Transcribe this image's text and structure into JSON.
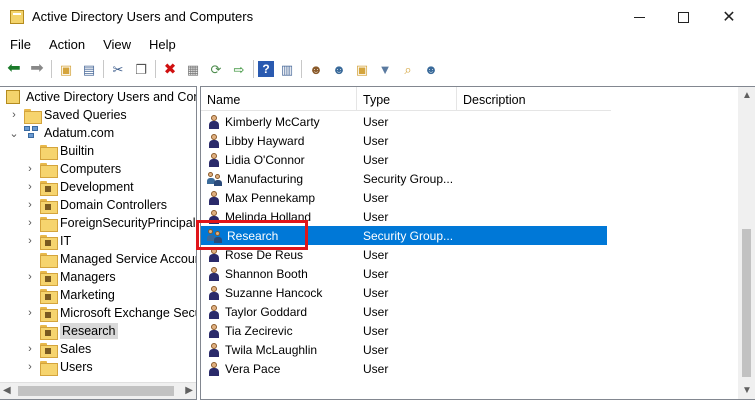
{
  "window": {
    "title": "Active Directory Users and Computers",
    "controls": {
      "minimize": "minimize",
      "maximize": "maximize",
      "close": "close"
    }
  },
  "menu": [
    "File",
    "Action",
    "View",
    "Help"
  ],
  "toolbar": {
    "icons": [
      "back-icon",
      "forward-icon",
      "up-folder-icon",
      "show-tree-icon",
      "cut-icon",
      "copy-icon",
      "delete-icon",
      "properties-icon",
      "refresh-icon",
      "export-icon",
      "help-icon",
      "console-icon",
      "new-user-icon",
      "new-group-icon",
      "new-ou-icon",
      "filter-icon",
      "find-icon",
      "add-to-group-icon"
    ]
  },
  "tree": {
    "root": "Active Directory Users and Com",
    "saved_queries": "Saved Queries",
    "domain": "Adatum.com",
    "children": [
      {
        "label": "Builtin",
        "type": "container",
        "expandable": false
      },
      {
        "label": "Computers",
        "type": "container",
        "expandable": true
      },
      {
        "label": "Development",
        "type": "ou",
        "expandable": true
      },
      {
        "label": "Domain Controllers",
        "type": "ou",
        "expandable": true
      },
      {
        "label": "ForeignSecurityPrincipals",
        "type": "container",
        "expandable": true
      },
      {
        "label": "IT",
        "type": "ou",
        "expandable": true
      },
      {
        "label": "Managed Service Accoun",
        "type": "container",
        "expandable": false
      },
      {
        "label": "Managers",
        "type": "ou",
        "expandable": true
      },
      {
        "label": "Marketing",
        "type": "ou",
        "expandable": false
      },
      {
        "label": "Microsoft Exchange Secu",
        "type": "ou",
        "expandable": true
      },
      {
        "label": "Research",
        "type": "ou",
        "expandable": false,
        "selected": true
      },
      {
        "label": "Sales",
        "type": "ou",
        "expandable": true
      },
      {
        "label": "Users",
        "type": "container",
        "expandable": true
      }
    ]
  },
  "list": {
    "columns": {
      "name": "Name",
      "type": "Type",
      "description": "Description"
    },
    "rows": [
      {
        "name": "Kimberly McCarty",
        "type": "User",
        "icon": "user-icon"
      },
      {
        "name": "Libby Hayward",
        "type": "User",
        "icon": "user-icon"
      },
      {
        "name": "Lidia O'Connor",
        "type": "User",
        "icon": "user-icon"
      },
      {
        "name": "Manufacturing",
        "type": "Security Group...",
        "icon": "group-icon"
      },
      {
        "name": "Max Pennekamp",
        "type": "User",
        "icon": "user-icon"
      },
      {
        "name": "Melinda Holland",
        "type": "User",
        "icon": "user-icon"
      },
      {
        "name": "Research",
        "type": "Security Group...",
        "icon": "group-icon",
        "selected": true
      },
      {
        "name": "Rose De Reus",
        "type": "User",
        "icon": "user-icon"
      },
      {
        "name": "Shannon Booth",
        "type": "User",
        "icon": "user-icon"
      },
      {
        "name": "Suzanne Hancock",
        "type": "User",
        "icon": "user-icon"
      },
      {
        "name": "Taylor Goddard",
        "type": "User",
        "icon": "user-icon"
      },
      {
        "name": "Tia Zecirevic",
        "type": "User",
        "icon": "user-icon"
      },
      {
        "name": "Twila McLaughlin",
        "type": "User",
        "icon": "user-icon"
      },
      {
        "name": "Vera Pace",
        "type": "User",
        "icon": "user-icon"
      }
    ]
  },
  "colors": {
    "selection": "#0078d7",
    "highlight_box": "#e0151a"
  }
}
